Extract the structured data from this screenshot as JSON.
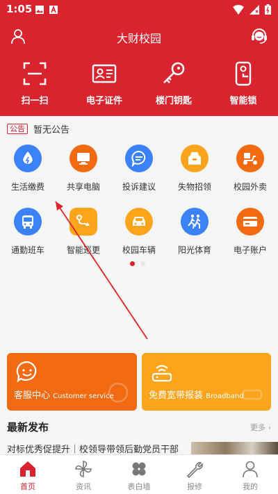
{
  "status_bar": {
    "time": "1:05"
  },
  "header": {
    "title": "大财校园"
  },
  "quick_actions": [
    {
      "label": "扫一扫",
      "icon": "scan-icon"
    },
    {
      "label": "电子证件",
      "icon": "id-card-icon"
    },
    {
      "label": "楼门钥匙",
      "icon": "key-icon"
    },
    {
      "label": "智能锁",
      "icon": "smart-lock-icon"
    }
  ],
  "notice": {
    "tag": "公告",
    "text": "暂无公告"
  },
  "services": [
    {
      "label": "生活缴费",
      "icon": "water-drop-icon",
      "color": "#3b82f6"
    },
    {
      "label": "共享电脑",
      "icon": "monitor-icon",
      "color": "#f26a12"
    },
    {
      "label": "投诉建议",
      "icon": "chat-icon",
      "color": "#3b82f6"
    },
    {
      "label": "失物招领",
      "icon": "box-icon",
      "color": "#fba41c"
    },
    {
      "label": "校园外卖",
      "icon": "scooter-icon",
      "color": "#f26a12"
    },
    {
      "label": "通勤班车",
      "icon": "bus-icon",
      "color": "#3b82f6"
    },
    {
      "label": "智能巡更",
      "icon": "route-icon",
      "color": "#fba41c"
    },
    {
      "label": "校园车辆",
      "icon": "car-icon",
      "color": "#fba41c"
    },
    {
      "label": "阳光体育",
      "icon": "runner-icon",
      "color": "#3b82f6"
    },
    {
      "label": "电子账户",
      "icon": "card-icon",
      "color": "#f26a12"
    }
  ],
  "cards": {
    "left": {
      "title": "客服中心",
      "subtitle": "Customer service",
      "color": "#f26a12"
    },
    "right": {
      "title": "免费宽带报装",
      "subtitle": "Broadband",
      "color": "#fba41c"
    }
  },
  "news": {
    "title": "最新发布",
    "more": "更多",
    "items": [
      {
        "text": "对标优秀促提升｜校领导带领后勤党员干部"
      }
    ]
  },
  "tabs": [
    {
      "label": "首页",
      "icon": "home-icon",
      "active": true
    },
    {
      "label": "资讯",
      "icon": "pinwheel-icon",
      "active": false
    },
    {
      "label": "表白墙",
      "icon": "clover-icon",
      "active": false
    },
    {
      "label": "报修",
      "icon": "wrench-icon",
      "active": false
    },
    {
      "label": "我的",
      "icon": "user-icon",
      "active": false
    }
  ],
  "colors": {
    "primary": "#d9232e",
    "orange": "#f26a12",
    "yellow": "#fba41c",
    "blue": "#3b82f6"
  }
}
